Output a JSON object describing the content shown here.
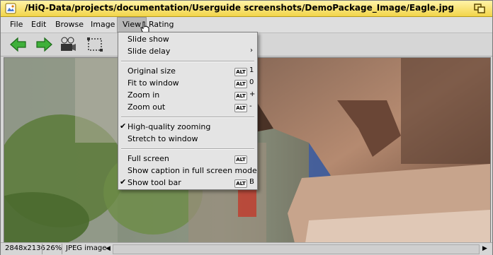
{
  "window": {
    "title": "/HiQ-Data/projects/documentation/Userguide screenshots/DemoPackage_Image/Eagle.jpg",
    "accent": "#f2d54a"
  },
  "menubar": {
    "items": [
      {
        "label": "File"
      },
      {
        "label": "Edit"
      },
      {
        "label": "Browse"
      },
      {
        "label": "Image"
      },
      {
        "label": "View"
      },
      {
        "label": "Rating"
      }
    ]
  },
  "toolbar": {
    "buttons": [
      {
        "icon": "arrow-left-icon"
      },
      {
        "icon": "arrow-right-icon"
      },
      {
        "icon": "slideshow-projector-icon"
      },
      {
        "icon": "selection-rectangle-icon"
      }
    ]
  },
  "view_menu": {
    "items": [
      {
        "label": "Slide show"
      },
      {
        "label": "Slide delay",
        "submenu": true
      },
      {
        "label": "Original size",
        "modifier": "ALT",
        "key": "1"
      },
      {
        "label": "Fit to window",
        "modifier": "ALT",
        "key": "0"
      },
      {
        "label": "Zoom in",
        "modifier": "ALT",
        "key": "+"
      },
      {
        "label": "Zoom out",
        "modifier": "ALT",
        "key": "-"
      },
      {
        "label": "High-quality zooming",
        "checked": true
      },
      {
        "label": "Stretch to window"
      },
      {
        "label": "Full screen",
        "modifier": "ALT",
        "key": ""
      },
      {
        "label": "Show caption in full screen mode"
      },
      {
        "label": "Show tool bar",
        "checked": true,
        "modifier": "ALT",
        "key": "B"
      }
    ]
  },
  "statusbar": {
    "dimensions": "2848x2136",
    "zoom": "26%",
    "type": "JPEG image"
  }
}
